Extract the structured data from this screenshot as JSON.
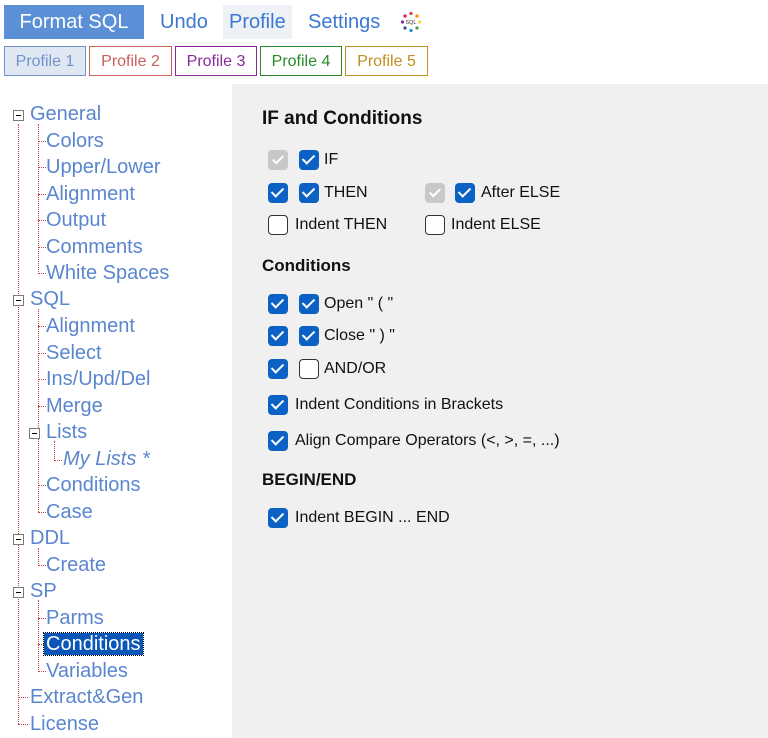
{
  "toolbar": {
    "format_sql": "Format SQL",
    "undo": "Undo",
    "profile": "Profile",
    "settings": "Settings",
    "logo_icon": "sql-logo-icon"
  },
  "profiles": [
    {
      "label": "Profile 1",
      "color": "#6f93c9"
    },
    {
      "label": "Profile 2",
      "color": "#c9605a"
    },
    {
      "label": "Profile 3",
      "color": "#8a2a9a"
    },
    {
      "label": "Profile 4",
      "color": "#2a8a2a"
    },
    {
      "label": "Profile 5",
      "color": "#c09020"
    }
  ],
  "tree": {
    "general": "General",
    "colors": "Colors",
    "upper_lower": "Upper/Lower",
    "alignment": "Alignment",
    "output": "Output",
    "comments": "Comments",
    "white_spaces": "White Spaces",
    "sql": "SQL",
    "sql_alignment": "Alignment",
    "select": "Select",
    "ins_upd_del": "Ins/Upd/Del",
    "merge": "Merge",
    "lists": "Lists",
    "my_lists": "My Lists *",
    "sql_conditions": "Conditions",
    "case": "Case",
    "ddl": "DDL",
    "create": "Create",
    "sp": "SP",
    "parms": "Parms",
    "sp_conditions": "Conditions",
    "variables": "Variables",
    "extract_gen": "Extract&Gen",
    "license": "License"
  },
  "main": {
    "section_if": "IF and Conditions",
    "if_label": "IF",
    "then_label": "THEN",
    "after_else_label": "After ELSE",
    "indent_then_label": "Indent THEN",
    "indent_else_label": "Indent ELSE",
    "section_conditions": "Conditions",
    "open_label": "Open \" ( \"",
    "close_label": "Close \" ) \"",
    "andor_label": "AND/OR",
    "indent_brackets_label": "Indent Conditions in Brackets",
    "align_compare_label": "Align Compare Operators (<, >, =, ...)",
    "section_begin": "BEGIN/END",
    "indent_begin_label": "Indent BEGIN ... END"
  },
  "colors": {
    "accent": "#0b62c4",
    "tree_text": "#5a86cf",
    "selected_bg": "#0a56b8"
  }
}
